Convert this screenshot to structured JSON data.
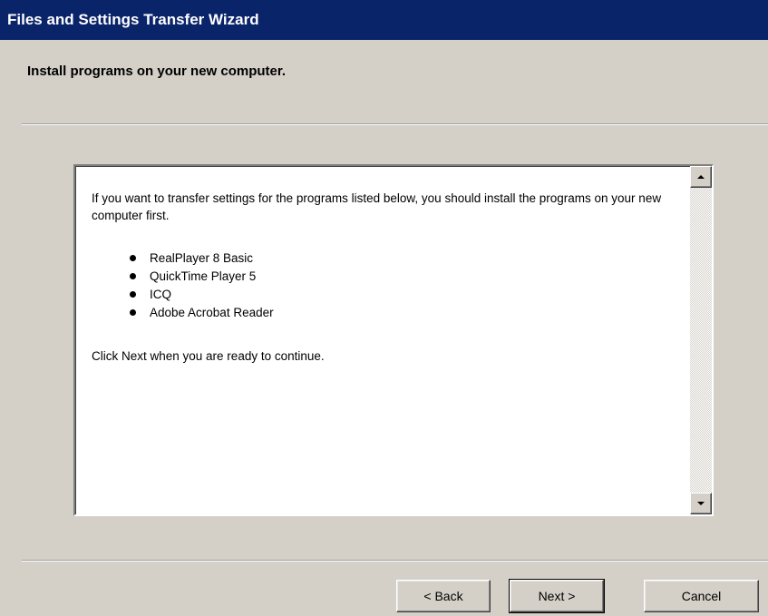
{
  "window": {
    "title": "Files and Settings Transfer Wizard"
  },
  "header": {
    "title": "Install programs on your new computer."
  },
  "content": {
    "intro": "If you want to transfer settings for the programs listed below, you should install the programs on your new computer first.",
    "programs": [
      "RealPlayer 8 Basic",
      "QuickTime Player 5",
      "ICQ",
      "Adobe Acrobat Reader"
    ],
    "closing": "Click Next when you are ready to continue."
  },
  "buttons": {
    "back": "< Back",
    "next": "Next >",
    "cancel": "Cancel"
  }
}
